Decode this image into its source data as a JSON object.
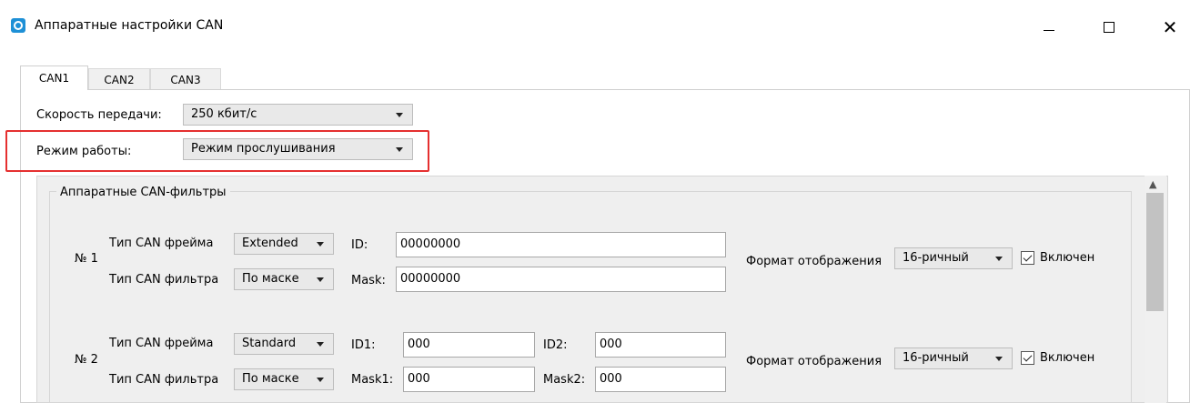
{
  "window": {
    "title": "Аппаратные настройки CAN",
    "close_glyph": "✕"
  },
  "tabs": [
    {
      "label": "CAN1",
      "active": true
    },
    {
      "label": "CAN2",
      "active": false
    },
    {
      "label": "CAN3",
      "active": false
    }
  ],
  "settings": {
    "speed_label": "Скорость передачи:",
    "speed_value": "250 кбит/с",
    "mode_label": "Режим работы:",
    "mode_value": "Режим прослушивания"
  },
  "filters": {
    "group_title": "Аппаратные CAN-фильтры",
    "items": [
      {
        "number": "№ 1",
        "frame_type_label": "Тип CAN фрейма",
        "frame_type_value": "Extended",
        "filter_type_label": "Тип CAN фильтра",
        "filter_type_value": "По маске",
        "id_label": "ID:",
        "id_value": "00000000",
        "mask_label": "Mask:",
        "mask_value": "00000000",
        "format_label": "Формат отображения",
        "format_value": "16-ричный",
        "enabled_label": "Включен",
        "enabled": true
      },
      {
        "number": "№ 2",
        "frame_type_label": "Тип CAN фрейма",
        "frame_type_value": "Standard",
        "filter_type_label": "Тип CAN фильтра",
        "filter_type_value": "По маске",
        "id1_label": "ID1:",
        "id1_value": "000",
        "id2_label": "ID2:",
        "id2_value": "000",
        "mask1_label": "Mask1:",
        "mask1_value": "000",
        "mask2_label": "Mask2:",
        "mask2_value": "000",
        "format_label": "Формат отображения",
        "format_value": "16-ричный",
        "enabled_label": "Включен",
        "enabled": true
      }
    ]
  },
  "colors": {
    "highlight": "#e53030",
    "app_icon": "#1e90d6"
  }
}
